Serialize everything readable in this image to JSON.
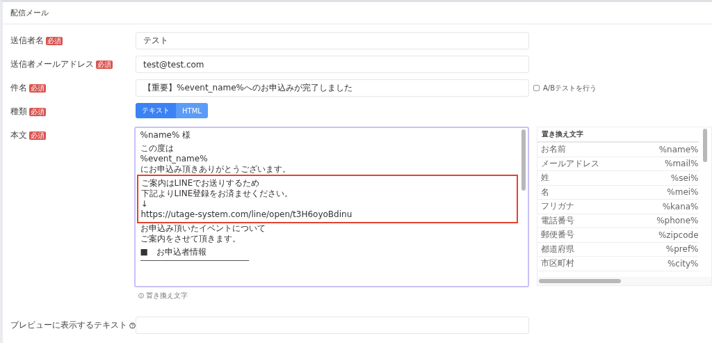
{
  "card": {
    "title": "配信メール"
  },
  "fields": [
    {
      "kind": "text",
      "label": "送信者名",
      "badge": "必須",
      "value": "テスト"
    },
    {
      "kind": "text",
      "label": "送信者メールアドレス",
      "badge": "必須",
      "value": "test@test.com"
    },
    {
      "kind": "subject",
      "label": "件名",
      "badge": "必須",
      "value": "【重要】%event_name%へのお申込みが完了しました",
      "checkbox": {
        "label": "A/Bテストを行う",
        "checked": false
      }
    },
    {
      "kind": "toggle",
      "label": "種類",
      "badge": "必須",
      "options": [
        {
          "label": "テキスト",
          "selected": true
        },
        {
          "label": "HTML",
          "selected": false
        }
      ]
    }
  ],
  "body": {
    "label": "本文",
    "badge": "必須",
    "blocks": [
      {
        "highlighted": false,
        "lines": [
          "%name% 様"
        ]
      },
      {
        "highlighted": false,
        "lines": [
          "この度は",
          "%event_name%",
          "にお申込み頂きありがとうございます。"
        ]
      },
      {
        "highlighted": true,
        "lines": [
          "ご案内はLINEでお送りするため",
          "下記よりLINE登録をお済ませください。",
          "↓",
          "https://utage-system.com/line/open/t3H6oyoBdinu"
        ]
      },
      {
        "highlighted": false,
        "lines": [
          "お申込み頂いたイベントについて",
          "ご案内をさせて頂きます。"
        ]
      },
      {
        "highlighted": false,
        "lines": [
          "■　お申込者情報"
        ],
        "rule": true
      }
    ],
    "hint": "置き換え文字",
    "table": {
      "title": "置き換え文字",
      "rows": [
        [
          "お名前",
          "%name%"
        ],
        [
          "メールアドレス",
          "%mail%"
        ],
        [
          "姓",
          "%sei%"
        ],
        [
          "名",
          "%mei%"
        ],
        [
          "フリガナ",
          "%kana%"
        ],
        [
          "電話番号",
          "%phone%"
        ],
        [
          "郵便番号",
          "%zipcode"
        ],
        [
          "都道府県",
          "%pref%"
        ],
        [
          "市区町村",
          "%city%"
        ]
      ]
    }
  },
  "preview": {
    "label": "プレビューに表示するテキスト"
  }
}
